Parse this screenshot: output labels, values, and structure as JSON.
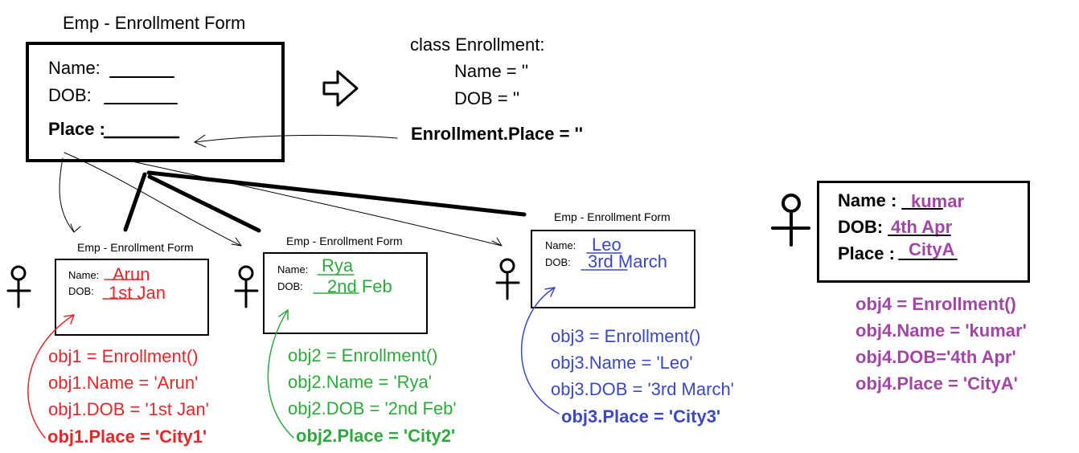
{
  "colors": {
    "black": "#000000",
    "obj1": "#e8262a",
    "obj2": "#2eaa3c",
    "obj3": "#3a48c8",
    "obj4": "#a246a6"
  },
  "main_form": {
    "title": "Emp - Enrollment Form",
    "name_label": "Name:",
    "dob_label": "DOB:",
    "place_label": "Place :"
  },
  "class_def": {
    "header": "class Enrollment:",
    "name_line": "Name = ''",
    "dob_line": "DOB = ''",
    "place_line": "Enrollment.Place = ''"
  },
  "forms": [
    {
      "title": "Emp - Enrollment Form",
      "name_label": "Name:",
      "dob_label": "DOB:",
      "name_value": "Arun",
      "dob_value": "1st Jan"
    },
    {
      "title": "Emp - Enrollment Form",
      "name_label": "Name:",
      "dob_label": "DOB:",
      "name_value": "Rya",
      "dob_value": "2nd Feb"
    },
    {
      "title": "Emp - Enrollment Form",
      "name_label": "Name:",
      "dob_label": "DOB:",
      "name_value": "Leo",
      "dob_value": "3rd March"
    },
    {
      "name_label": "Name :",
      "dob_label": "DOB:",
      "place_label": "Place :",
      "name_value": "kumar",
      "dob_value": "4th Apr",
      "place_value": "CityA"
    }
  ],
  "code": [
    {
      "create": "obj1 = Enrollment()",
      "name": "obj1.Name = 'Arun'",
      "dob": "obj1.DOB = '1st Jan'",
      "place": "obj1.Place = 'City1'"
    },
    {
      "create": "obj2 = Enrollment()",
      "name": "obj2.Name = 'Rya'",
      "dob": "obj2.DOB = '2nd Feb'",
      "place": "obj2.Place = 'City2'"
    },
    {
      "create": "obj3 = Enrollment()",
      "name": "obj3.Name = 'Leo'",
      "dob": "obj3.DOB = '3rd March'",
      "place": "obj3.Place = 'City3'"
    },
    {
      "create": "obj4 = Enrollment()",
      "name": "obj4.Name = 'kumar'",
      "dob": "obj4.DOB='4th Apr'",
      "place": "obj4.Place = 'CityA'"
    }
  ]
}
